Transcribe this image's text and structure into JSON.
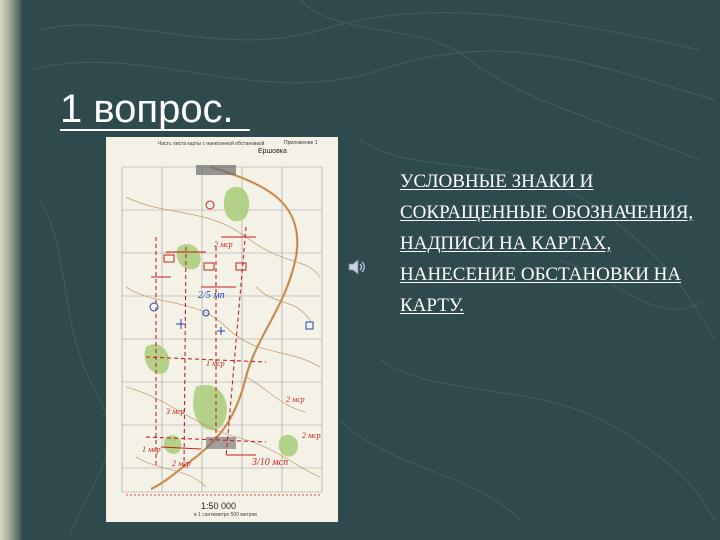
{
  "slide": {
    "title": "1 вопрос.",
    "body": "УСЛОВНЫЕ  ЗНАКИ И СОКРАЩЕННЫЕ  ОБОЗНАЧЕНИЯ, НАДПИСИ НА КАРТАХ, НАНЕСЕНИЕ ОБСТАНОВКИ НА КАРТУ."
  },
  "map": {
    "caption": "Часть листа карты с нанесенной обстановкой",
    "annex": "Приложение 1",
    "town": "Ершовка",
    "scale": "1:50 000",
    "scale_note": "в 1 сантиметре 500 метров",
    "labels": {
      "a": "2 мср",
      "b": "2/5 мп",
      "c": "1 мср",
      "d": "3 мср",
      "e": "2 мср",
      "f": "3/10 мсп",
      "g": "1 мср",
      "h": "2 мср",
      "i": "2 мср"
    }
  },
  "colors": {
    "background": "#2f4a4c",
    "text": "#ffffff",
    "map_red": "#c81e1e",
    "map_blue": "#1e46b4"
  },
  "icons": {
    "audio": "speaker-icon"
  }
}
